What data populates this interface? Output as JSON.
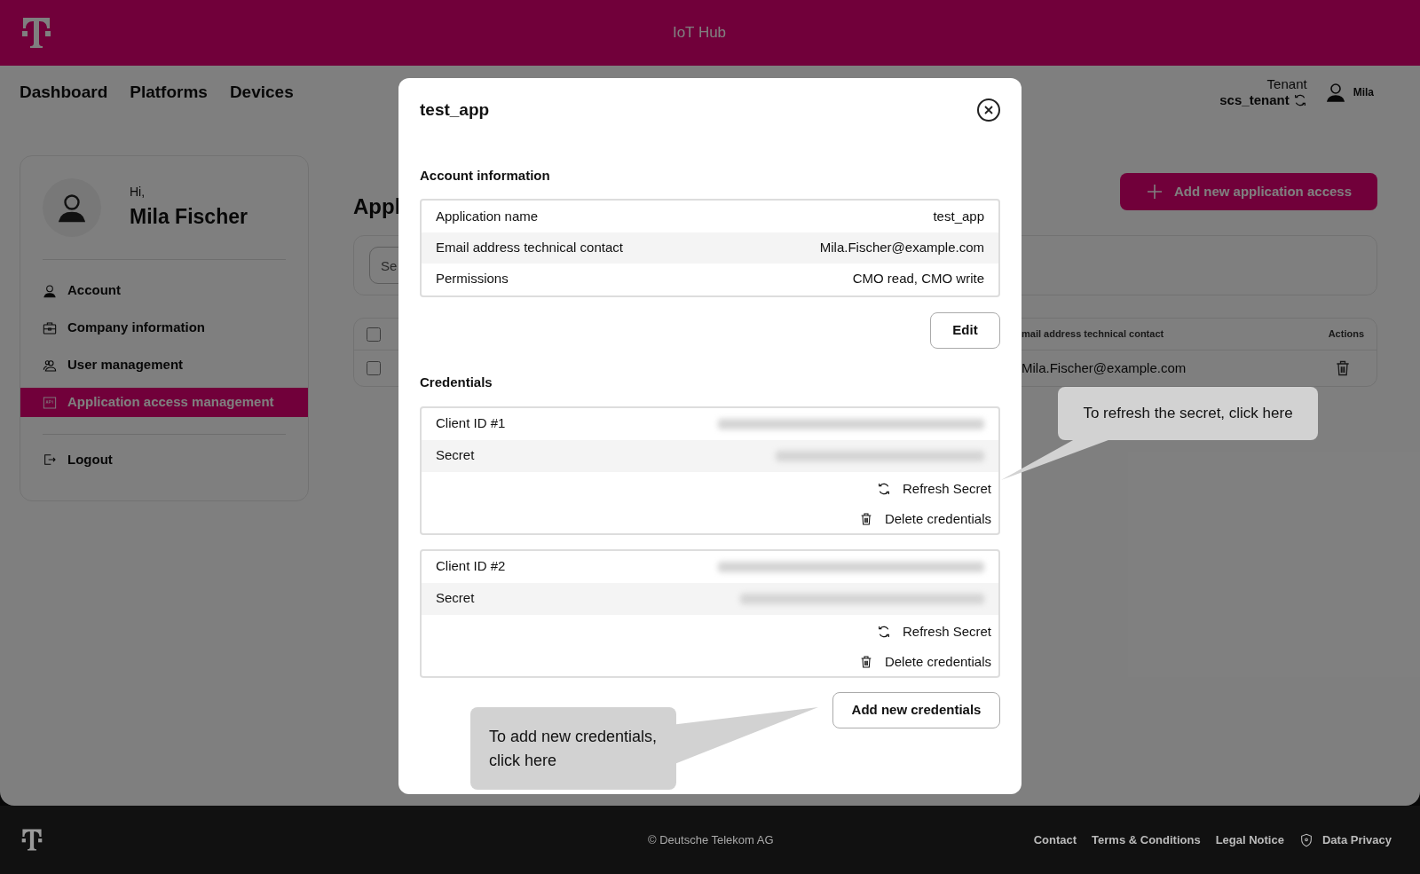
{
  "header": {
    "title": "IoT Hub"
  },
  "nav": {
    "items": [
      {
        "label": "Dashboard"
      },
      {
        "label": "Platforms"
      },
      {
        "label": "Devices"
      }
    ],
    "tenant_label": "Tenant",
    "tenant": "scs_tenant",
    "user": "Mila"
  },
  "sidebar": {
    "greeting": "Hi,",
    "name": "Mila Fischer",
    "items": [
      {
        "label": "Account",
        "selected": false
      },
      {
        "label": "Company information",
        "selected": false
      },
      {
        "label": "User management",
        "selected": false
      },
      {
        "label": "Application access management",
        "selected": true
      }
    ],
    "logout": "Logout"
  },
  "page": {
    "heading": "Appl",
    "add_button": "Add new application access",
    "search_placeholder": "Se",
    "table": {
      "header_checked": false,
      "columns": [
        "mail address technical contact",
        "Actions"
      ],
      "rows": [
        {
          "email": "Mila.Fischer@example.com",
          "checked": false
        }
      ]
    }
  },
  "modal": {
    "title": "test_app",
    "account_section": "Account information",
    "account_rows": [
      {
        "label": "Application name",
        "value": "test_app"
      },
      {
        "label": "Email address technical contact",
        "value": "Mila.Fischer@example.com"
      },
      {
        "label": "Permissions",
        "value": "CMO read, CMO write"
      }
    ],
    "edit_button": "Edit",
    "credentials_section": "Credentials",
    "credentials": [
      {
        "client_label": "Client ID #1",
        "secret_label": "Secret",
        "refresh": "Refresh Secret",
        "delete": "Delete credentials"
      },
      {
        "client_label": "Client ID #2",
        "secret_label": "Secret",
        "refresh": "Refresh Secret",
        "delete": "Delete credentials"
      }
    ],
    "add_button": "Add new credentials"
  },
  "callouts": [
    {
      "text": "To refresh the secret, click here"
    },
    {
      "text": "To add new credentials, click here"
    }
  ],
  "footer": {
    "copyright": "© Deutsche Telekom AG",
    "links": [
      {
        "label": "Contact",
        "kind": "plain"
      },
      {
        "label": "Terms & Conditions",
        "kind": "plain"
      },
      {
        "label": "Legal Notice",
        "kind": "plain"
      },
      {
        "label": "Data Privacy",
        "kind": "privacy"
      }
    ]
  }
}
